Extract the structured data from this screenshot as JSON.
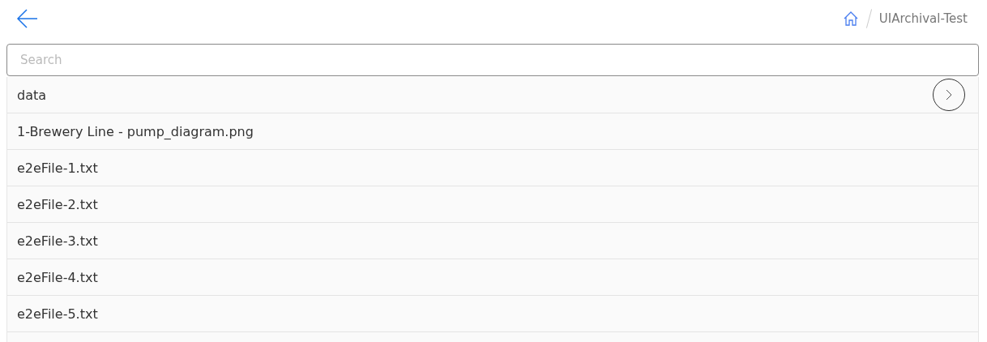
{
  "breadcrumb": {
    "current": "UIArchival-Test"
  },
  "search": {
    "placeholder": "Search"
  },
  "items": [
    {
      "name": "data",
      "kind": "folder"
    },
    {
      "name": "1-Brewery Line - pump_diagram.png",
      "kind": "file"
    },
    {
      "name": "e2eFile-1.txt",
      "kind": "file"
    },
    {
      "name": "e2eFile-2.txt",
      "kind": "file"
    },
    {
      "name": "e2eFile-3.txt",
      "kind": "file"
    },
    {
      "name": "e2eFile-4.txt",
      "kind": "file"
    },
    {
      "name": "e2eFile-5.txt",
      "kind": "file"
    }
  ]
}
